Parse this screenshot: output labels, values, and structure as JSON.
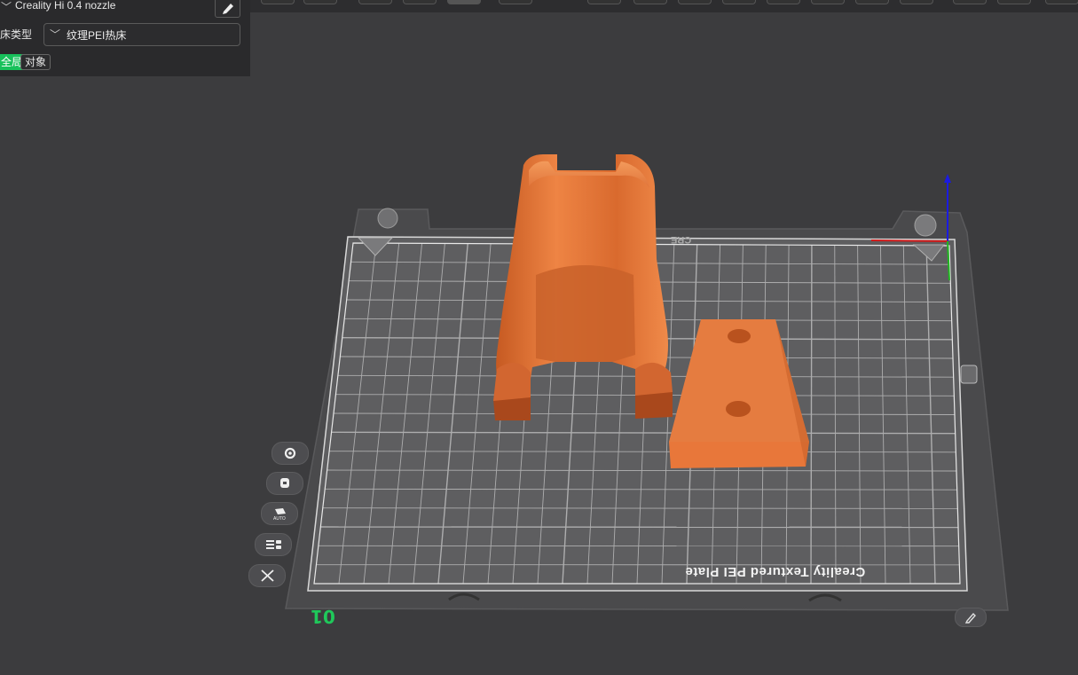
{
  "window": {
    "printer_name": "Creality Hi 0.4 nozzle",
    "bed_type_label": "热床类型",
    "bed_type_value": "纹理PEI热床",
    "scope_tabs": [
      {
        "label": "全局",
        "active": true
      },
      {
        "label": "对象",
        "active": false
      }
    ]
  },
  "plate": {
    "number": "01",
    "label": "Creality Textured PEI Plate",
    "brand_text": "CRE"
  },
  "side_tools": [
    {
      "name": "gear-icon"
    },
    {
      "name": "arrange-icon"
    },
    {
      "name": "auto-orient-icon"
    },
    {
      "name": "layers-icon"
    },
    {
      "name": "close-icon"
    }
  ],
  "colors": {
    "model": "#e87a3c",
    "accent": "#17c15b",
    "background": "#3c3c3e",
    "panel": "#2a2a2c"
  }
}
